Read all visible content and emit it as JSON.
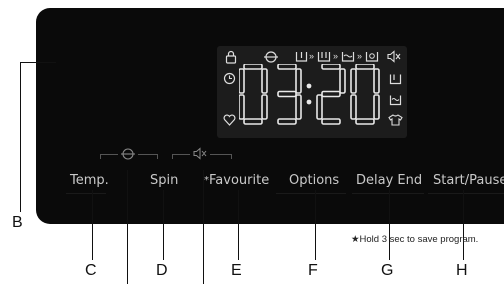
{
  "display": {
    "time_left": "03",
    "time_sep": ":",
    "time_right": "20"
  },
  "buttons": {
    "temp": "Temp.",
    "spin": "Spin",
    "favourite": "Favourite",
    "favourite_marker": "*",
    "options": "Options",
    "delay_end": "Delay End",
    "start_pause": "Start/Pause"
  },
  "note": "★Hold 3 sec to save program.",
  "callouts": {
    "b": "B",
    "c": "C",
    "d": "D",
    "e": "E",
    "f": "F",
    "g": "G",
    "h": "H"
  },
  "icons": {
    "lock": "lock-icon",
    "clock": "clock-icon",
    "heart": "heart-icon",
    "drum": "drum-icon",
    "prewash": "prewash-icon",
    "wash": "wash-icon",
    "rinse": "rinse-icon",
    "spin_stage": "spin-stage-icon",
    "mute": "mute-icon",
    "shirt": "shirt-icon"
  },
  "colors": {
    "panel": "#0a0a0a",
    "display_bg": "#1c1c1c",
    "segment": "#e8e8e8",
    "label": "#c9c9c9"
  }
}
